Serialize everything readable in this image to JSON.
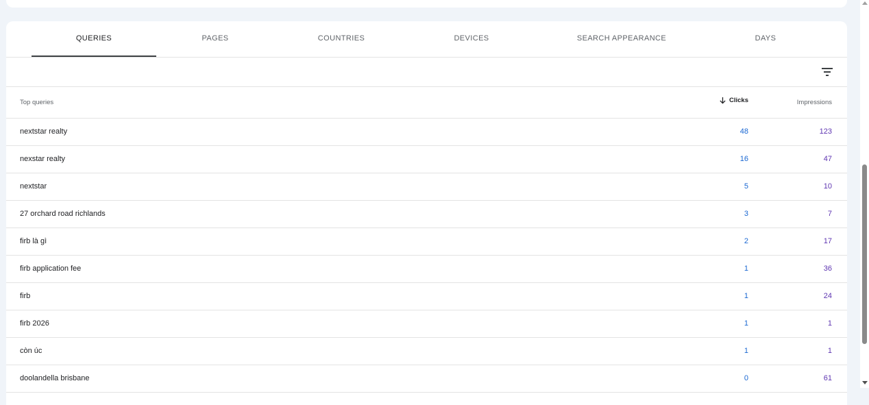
{
  "tabs": [
    {
      "label": "QUERIES",
      "active": true
    },
    {
      "label": "PAGES",
      "active": false
    },
    {
      "label": "COUNTRIES",
      "active": false
    },
    {
      "label": "DEVICES",
      "active": false
    },
    {
      "label": "SEARCH APPEARANCE",
      "active": false
    },
    {
      "label": "DAYS",
      "active": false
    }
  ],
  "filter": {
    "icon": "filter-list-icon"
  },
  "table": {
    "headers": {
      "query": "Top queries",
      "clicks": "Clicks",
      "impressions": "Impressions",
      "sort_icon": "arrow-down-icon"
    },
    "rows": [
      {
        "query": "nextstar realty",
        "clicks": "48",
        "impressions": "123"
      },
      {
        "query": "nexstar realty",
        "clicks": "16",
        "impressions": "47"
      },
      {
        "query": "nextstar",
        "clicks": "5",
        "impressions": "10"
      },
      {
        "query": "27 orchard road richlands",
        "clicks": "3",
        "impressions": "7"
      },
      {
        "query": "firb là gì",
        "clicks": "2",
        "impressions": "17"
      },
      {
        "query": "firb application fee",
        "clicks": "1",
        "impressions": "36"
      },
      {
        "query": "firb",
        "clicks": "1",
        "impressions": "24"
      },
      {
        "query": "firb 2026",
        "clicks": "1",
        "impressions": "1"
      },
      {
        "query": "còn úc",
        "clicks": "1",
        "impressions": "1"
      },
      {
        "query": "doolandella brisbane",
        "clicks": "0",
        "impressions": "61"
      }
    ]
  },
  "colors": {
    "clicks": "#1967d2",
    "impressions": "#5e35b1",
    "background": "#f0f4f9"
  }
}
